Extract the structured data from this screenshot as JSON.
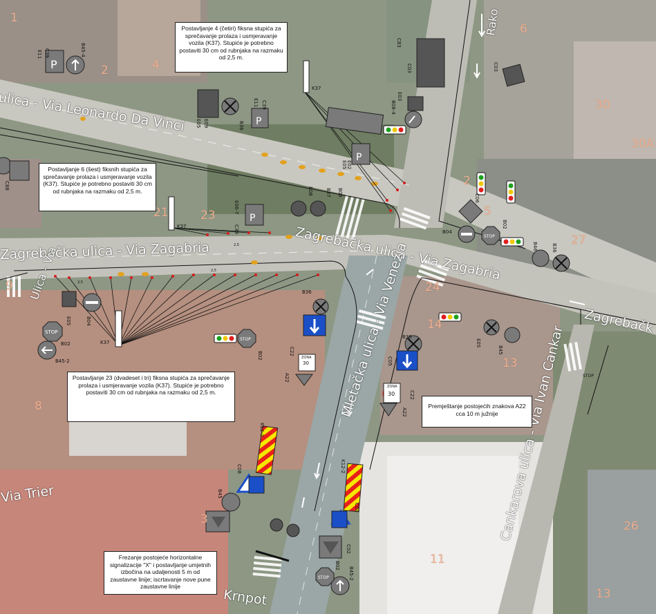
{
  "notes": {
    "n1": "Postavljanje 4 (četiri) fiksna stupića za sprečavanje prolaza i usmjeravanje vozila (K37). Stupiće je potrebno postaviti 30 cm od rubnjaka na razmaku od 2,5 m.",
    "n2": "Postavljanje 6 (šest) fiksnih stupića za sprečavanje prolaza i usmjeravanje vozila (K37). Stupiće je potrebno postaviti 30 cm od rubnjaka na razmaku od 2,5 m.",
    "n3": "Postavljanje 23 (dvadeset i tri) fiksna stupića za sprečavanje prolaza i usmjeravanje vozila (K37). Stupiće je potrebno postaviti 30 cm od rubnjaka na razmaku od 2,5 m.",
    "n4": "Premještanje postojećih znakova A22 cca 10 m južnije",
    "n5": "Frezanje postojeće horizontalne signalizacije \"X\" i postavljanje umjetnih izbočina na udaljenosti 5 m od zaustavne linije; iscrtavanje nove pune zaustavne linije"
  },
  "streets": {
    "s1": "ulica - Via Leonardo Da Vinci",
    "s2": "Zagrebačka ulica - Via Zagabria",
    "s3": "Zagrebačka ulica - Via Zagabria",
    "s4": "Zagrebačk",
    "s5": "Mletačka ulica - Via Venezia",
    "s6": "Cankarova ulica - Via Ivan Cankar",
    "s7": "Via Trier",
    "s8": "Krnpot",
    "s9": "Rako",
    "s10": "Ulica - Via"
  },
  "house_numbers": [
    "1",
    "2",
    "4",
    "6",
    "30",
    "30A",
    "2",
    "21",
    "23",
    "27",
    "24",
    "14",
    "13",
    "9",
    "8",
    "5",
    "3",
    "11",
    "26",
    "13"
  ],
  "sign_codes": {
    "k37": "K37",
    "c39": "C39",
    "e11": "E11",
    "b45_4": "B45-4",
    "b36": "B36",
    "e05": "E05",
    "c83": "C83",
    "c03": "C03",
    "e03": "E03",
    "b08_4": "B08-4",
    "e06_7": "E06-7",
    "b08": "B08",
    "b37": "B37",
    "b06": "B06",
    "c06": "C06",
    "b04": "B04",
    "b02": "B02",
    "b46": "B46",
    "c05": "C05",
    "c22": "C22",
    "a22": "A22",
    "b45": "B45",
    "b45_2": "B45-2",
    "k12_3": "K12-3",
    "k12_2": "K12-2",
    "c08": "C08",
    "c02": "C02",
    "b45_6": "B45",
    "e09": "E09",
    "e02": "E02",
    "c88": "C88"
  },
  "sign_texts": {
    "stop": "STOP",
    "zona": "ZONA",
    "speed": "30",
    "parking": "P",
    "dim": "2,5"
  },
  "colors": {
    "road": "#cfcfc6",
    "bollard": "#e0a020",
    "signal_red": "#e01e1e",
    "signal_yellow": "#f0c800",
    "signal_green": "#1ea01e",
    "sign_blue": "#1a4fc8",
    "sign_gray": "#7a7a7a",
    "stripe_yellow": "#f5e800",
    "stripe_red": "#e8201a"
  }
}
